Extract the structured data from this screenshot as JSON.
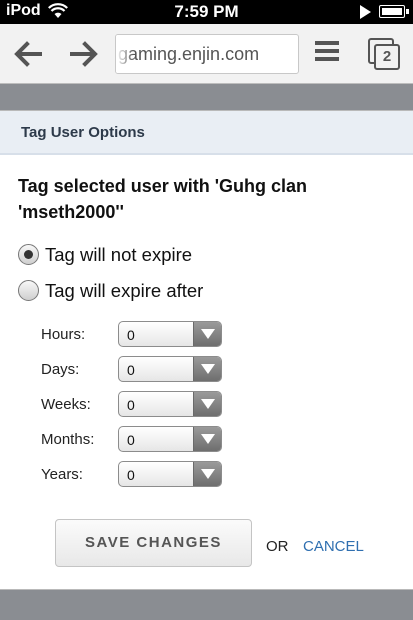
{
  "status_bar": {
    "carrier": "iPod",
    "time": "7:59 PM",
    "icons": [
      "wifi-icon",
      "play-icon",
      "battery-icon"
    ]
  },
  "browser": {
    "back_icon": "arrow-left-icon",
    "forward_icon": "arrow-right-icon",
    "url": "gaming.enjin.com",
    "menu_icon": "hamburger-menu-icon",
    "tab_count": "2"
  },
  "dialog": {
    "header": "Tag User Options",
    "title": "Tag selected user with 'Guhg clan 'mseth2000''",
    "options": [
      {
        "label": "Tag will not expire",
        "checked": true
      },
      {
        "label": "Tag will expire after",
        "checked": false
      }
    ],
    "fields": [
      {
        "label": "Hours:",
        "value": "0"
      },
      {
        "label": "Days:",
        "value": "0"
      },
      {
        "label": "Weeks:",
        "value": "0"
      },
      {
        "label": "Months:",
        "value": "0"
      },
      {
        "label": "Years:",
        "value": "0"
      }
    ],
    "save_label": "SAVE CHANGES",
    "or_text": "OR",
    "cancel_label": "CANCEL"
  },
  "colors": {
    "header_bg": "#e9eef4",
    "link": "#2f6fb0",
    "backdrop": "#8a8d92"
  }
}
